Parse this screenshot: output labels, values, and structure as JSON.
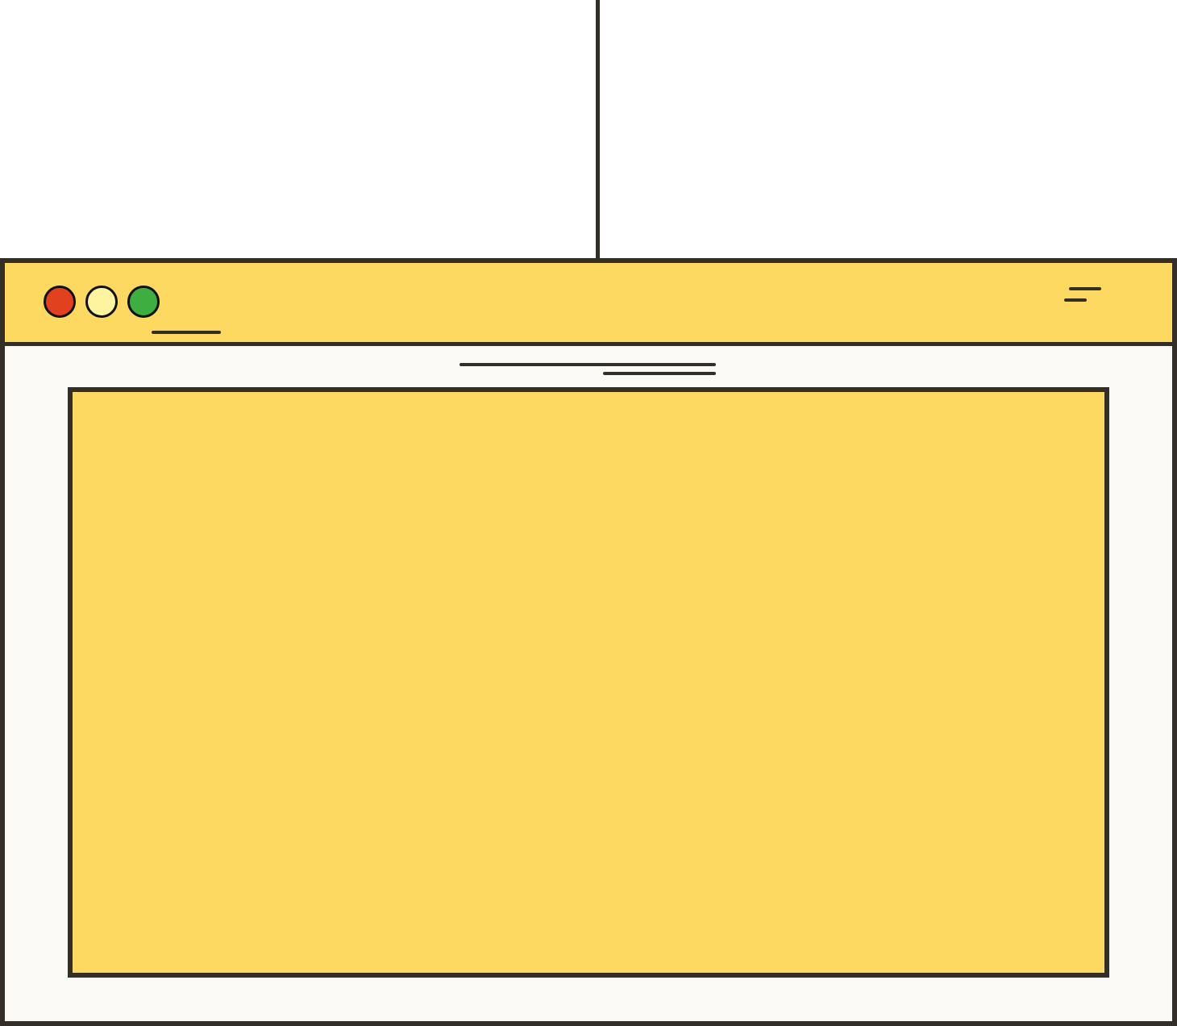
{
  "window": {
    "title": "",
    "controls": [
      {
        "name": "close",
        "color": "#e2411f"
      },
      {
        "name": "minimize",
        "color": "#fef4a0"
      },
      {
        "name": "maximize",
        "color": "#3dae3f"
      }
    ]
  },
  "colors": {
    "outline": "#332f26",
    "titlebar": "#fdd961",
    "content_background": "#faf9f6",
    "panel": "#fdd961"
  },
  "icons": {
    "menu": "menu-icon"
  },
  "content": {
    "heading": ""
  }
}
